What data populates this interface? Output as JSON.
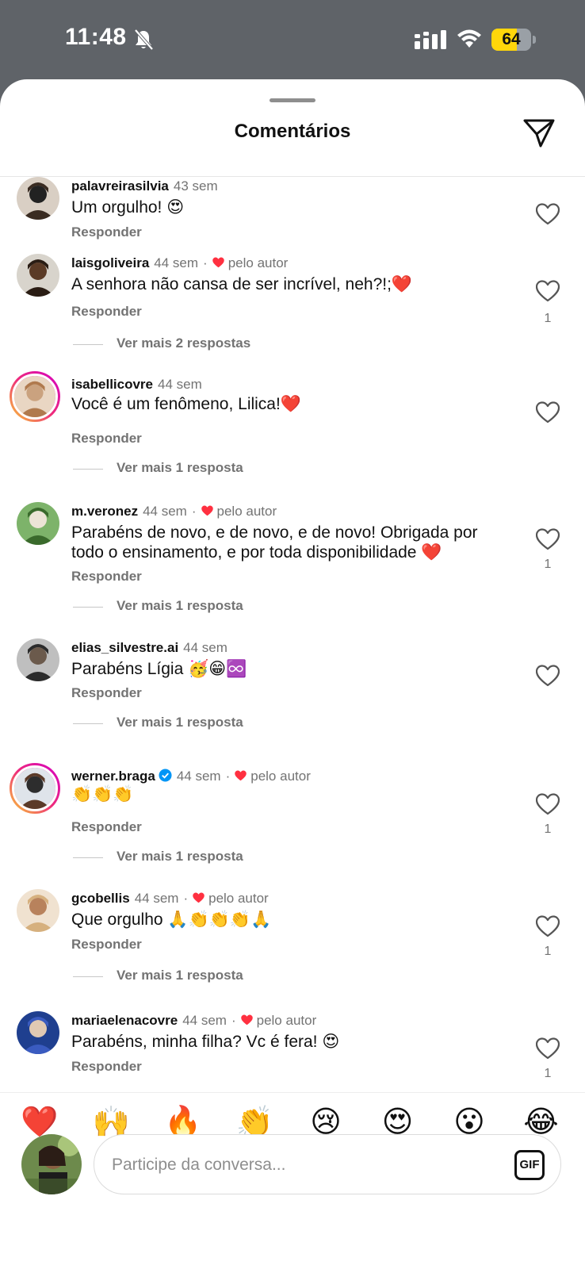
{
  "status_bar": {
    "time": "11:48",
    "battery_level": "64",
    "battery_percent": 64
  },
  "header": {
    "title": "Comentários",
    "share_icon": "send-icon"
  },
  "labels": {
    "reply": "Responder"
  },
  "comments": [
    {
      "username": "palavreirasilvia",
      "time": "43 sem",
      "liked_by_author": false,
      "text": "Um orgulho! 😍",
      "likes": ""
    },
    {
      "username": "laisgoliveira",
      "time": "44 sem",
      "liked_by_author": true,
      "author_label": "pelo autor",
      "text": "A senhora não cansa de ser incrível, neh?!;❤️",
      "likes": "1",
      "more_replies": "Ver mais 2 respostas"
    },
    {
      "username": "isabellicovre",
      "time": "44 sem",
      "liked_by_author": false,
      "text": "Você é um fenômeno, Lilica!❤️",
      "likes": "",
      "more_replies": "Ver mais 1 resposta"
    },
    {
      "username": "m.veronez",
      "time": "44 sem",
      "liked_by_author": true,
      "author_label": "pelo autor",
      "text": "Parabéns de novo, e de novo, e de novo! Obrigada por todo o ensinamento, e por toda disponibilidade ❤️",
      "likes": "1",
      "more_replies": "Ver mais 1 resposta"
    },
    {
      "username": "elias_silvestre.ai",
      "time": "44 sem",
      "liked_by_author": false,
      "text": "Parabéns Lígia 🥳😁♾️",
      "likes": "",
      "more_replies": "Ver mais 1 resposta"
    },
    {
      "username": "werner.braga",
      "verified": true,
      "time": "44 sem",
      "liked_by_author": true,
      "author_label": "pelo autor",
      "text": "👏👏👏",
      "likes": "1",
      "more_replies": "Ver mais 1 resposta"
    },
    {
      "username": "gcobellis",
      "time": "44 sem",
      "liked_by_author": true,
      "author_label": "pelo autor",
      "text": "Que orgulho 🙏👏👏👏🙏",
      "likes": "1",
      "more_replies": "Ver mais 1 resposta"
    },
    {
      "username": "mariaelenacovre",
      "time": "44 sem",
      "liked_by_author": true,
      "author_label": "pelo autor",
      "text": "Parabéns, minha filha? Vc é fera! 😍",
      "likes": "1"
    }
  ],
  "emoji_bar": [
    "❤️",
    "🙌",
    "🔥",
    "👏",
    "😢",
    "😍",
    "😮",
    "😂"
  ],
  "composer": {
    "placeholder": "Participe da conversa...",
    "gif_label": "GIF"
  },
  "colors": {
    "heart_red": "#ff3040",
    "secondary_text": "#737373",
    "verified_blue": "#0095f6"
  }
}
